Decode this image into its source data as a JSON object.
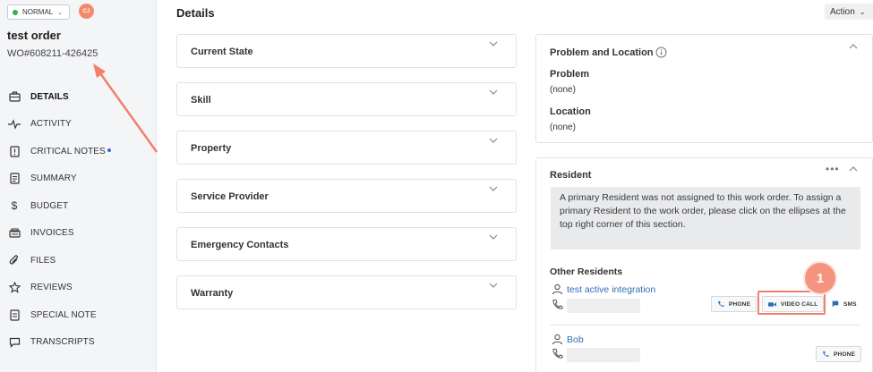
{
  "header": {
    "status": "NORMAL",
    "avatar_initials": "CJ",
    "order_title": "test order",
    "wo_number": "WO#608211-426425"
  },
  "sidebar": {
    "items": [
      {
        "label": "DETAILS",
        "icon": "briefcase-icon"
      },
      {
        "label": "ACTIVITY",
        "icon": "activity-icon"
      },
      {
        "label": "CRITICAL NOTES",
        "icon": "note-alert-icon"
      },
      {
        "label": "SUMMARY",
        "icon": "document-icon"
      },
      {
        "label": "BUDGET",
        "icon": "dollar-icon"
      },
      {
        "label": "INVOICES",
        "icon": "invoice-icon"
      },
      {
        "label": "FILES",
        "icon": "paperclip-icon"
      },
      {
        "label": "REVIEWS",
        "icon": "star-icon"
      },
      {
        "label": "SPECIAL NOTE",
        "icon": "special-note-icon"
      },
      {
        "label": "TRANSCRIPTS",
        "icon": "chat-icon"
      }
    ]
  },
  "main": {
    "title": "Details",
    "action_label": "Action",
    "sections": [
      {
        "label": "Current State"
      },
      {
        "label": "Skill"
      },
      {
        "label": "Property"
      },
      {
        "label": "Service Provider"
      },
      {
        "label": "Emergency Contacts"
      },
      {
        "label": "Warranty"
      }
    ]
  },
  "problem_card": {
    "title": "Problem and Location",
    "problem_label": "Problem",
    "problem_value": "(none)",
    "location_label": "Location",
    "location_value": "(none)"
  },
  "resident_card": {
    "title": "Resident",
    "alert": "A primary Resident was not assigned to this work order. To assign a primary Resident to the work order, please click on the ellipses at the top right corner of this section.",
    "other_residents_label": "Other Residents",
    "residents": [
      {
        "name": "test active integration",
        "buttons": [
          "PHONE",
          "VIDEO CALL",
          "SMS"
        ]
      },
      {
        "name": "Bob",
        "buttons": [
          "PHONE"
        ]
      }
    ]
  },
  "annotation": {
    "step_number": "1"
  },
  "colors": {
    "accent_link": "#2f6fb5",
    "status_green": "#2eb24a",
    "annotation": "#f2806a"
  }
}
